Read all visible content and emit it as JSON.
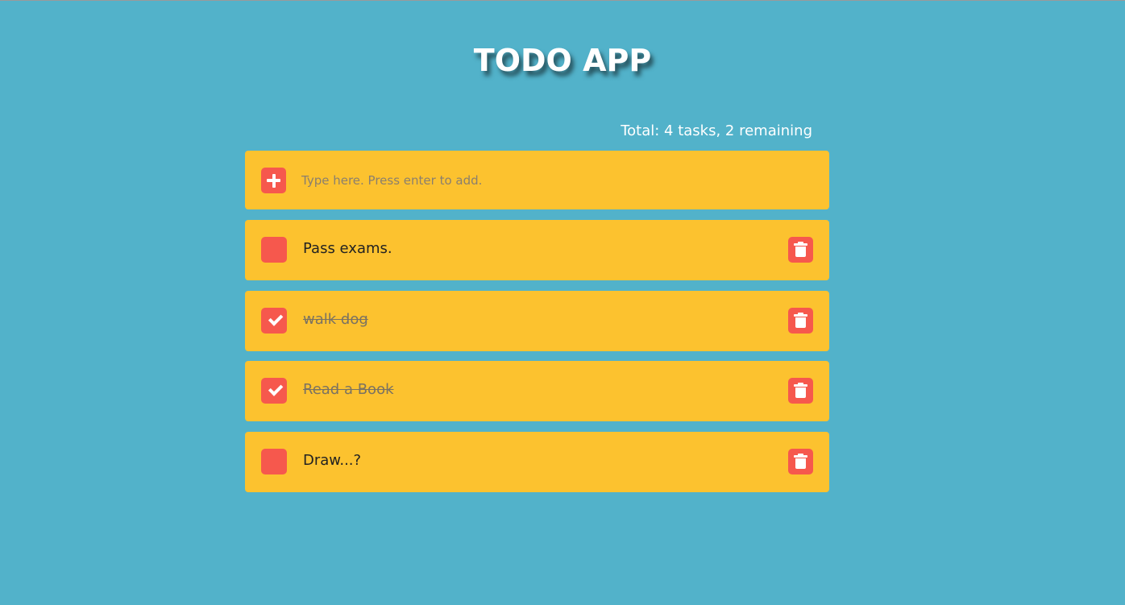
{
  "app": {
    "title": "TODO APP",
    "summary": "Total: 4 tasks, 2 remaining"
  },
  "add": {
    "placeholder": "Type here. Press enter to add.",
    "value": "",
    "icon": "plus-icon"
  },
  "tasks": [
    {
      "text": "Pass exams.",
      "done": false
    },
    {
      "text": "walk dog",
      "done": true
    },
    {
      "text": "Read a Book",
      "done": true
    },
    {
      "text": "Draw...?",
      "done": false
    }
  ],
  "colors": {
    "background": "#52b2ca",
    "card": "#fcc22f",
    "accent": "#f6584d",
    "title": "#ffffff"
  }
}
